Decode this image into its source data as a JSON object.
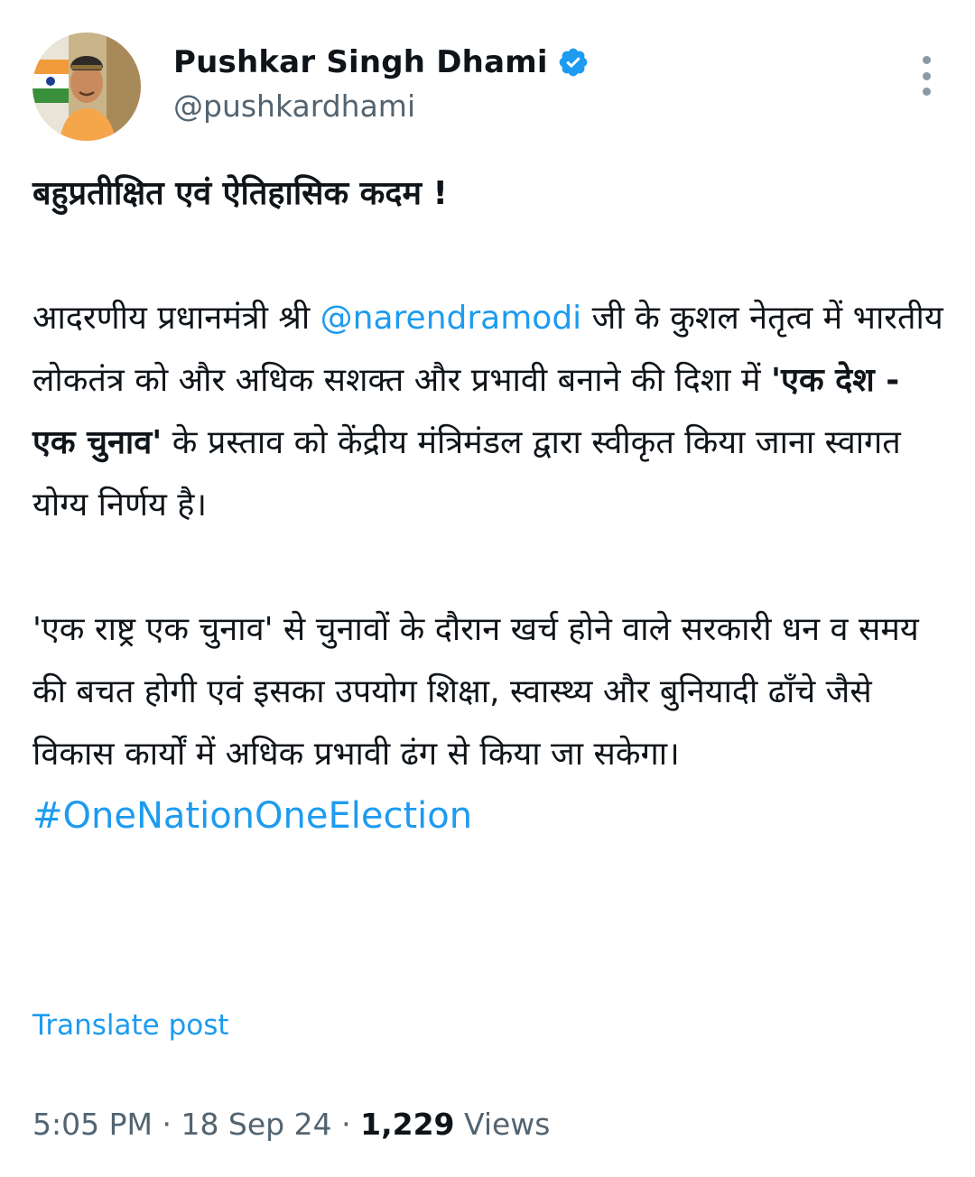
{
  "author": {
    "display_name": "Pushkar Singh Dhami",
    "handle": "@pushkardhami",
    "verified": true
  },
  "colors": {
    "link": "#1d9bf0",
    "text": "#0f1419",
    "secondary": "#536471"
  },
  "icons": {
    "verified": "verified-badge-icon",
    "more": "more-options-icon",
    "avatar": "profile-avatar"
  },
  "post": {
    "headline": "बहुप्रतीक्षित एवं ऐतिहासिक कदम !",
    "para1": {
      "before_mention": "आदरणीय प्रधानमंत्री श्री ",
      "mention": "@narendramodi",
      "after_mention": " जी के कुशल नेतृत्व में भारतीय लोकतंत्र को और अधिक सशक्त और प्रभावी बनाने की दिशा में ",
      "quote": "'एक देश - एक चुनाव'",
      "after_quote": " के प्रस्ताव को केंद्रीय मंत्रिमंडल द्वारा स्वीकृत किया जाना स्वागत योग्य निर्णय है।"
    },
    "para2": "'एक राष्ट्र एक चुनाव' से चुनावों के दौरान खर्च होने वाले सरकारी धन व समय की बचत होगी एवं इसका उपयोग शिक्षा, स्वास्थ्य और बुनियादी ढाँचे जैसे विकास कार्यों में अधिक प्रभावी ढंग से किया जा सकेगा।",
    "hashtag": "#OneNationOneElection"
  },
  "translate_label": "Translate post",
  "meta": {
    "time": "5:05 PM",
    "separator": " · ",
    "date": "18 Sep 24",
    "views_count": "1,229",
    "views_label": " Views"
  }
}
